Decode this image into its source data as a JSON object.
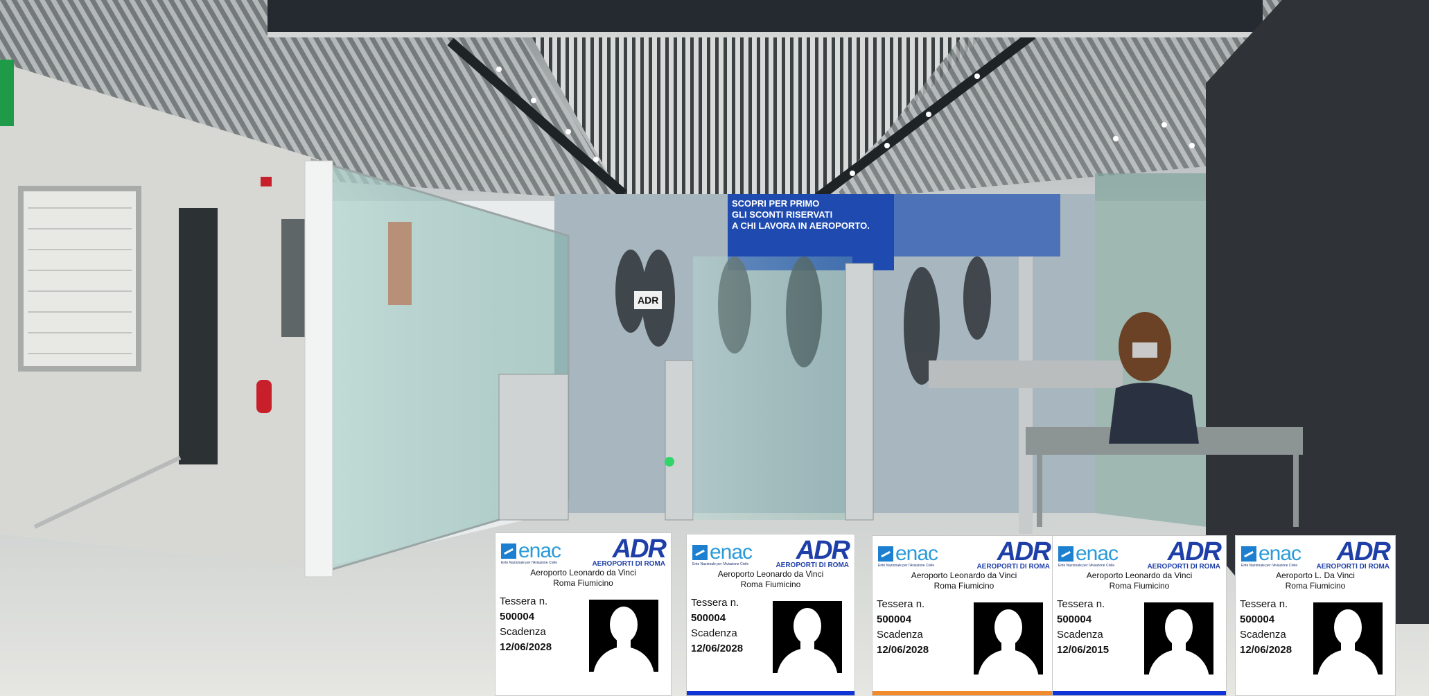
{
  "scene": {
    "signage_text": [
      "SCOPRI PER PRIMO",
      "GLI SCONTI RISERVATI",
      "A CHI LAVORA IN AEROPORTO."
    ],
    "gate_brand": "ADR"
  },
  "badges": [
    {
      "enac_logo": "enac",
      "enac_subtitle": "Ente Nazionale per l'Aviazione Civile",
      "adr_logo": "ADR",
      "adr_subtitle": "AEROPORTI DI ROMA",
      "airport_line1": "Aeroporto Leonardo da Vinci",
      "airport_line2": "Roma Fiumicino",
      "tessera_label": "Tessera n.",
      "tessera_number": "500004",
      "scadenza_label": "Scadenza",
      "scadenza_date": "12/06/2028",
      "band_color": "#ffffff"
    },
    {
      "enac_logo": "enac",
      "enac_subtitle": "Ente Nazionale per l'Aviazione Civile",
      "adr_logo": "ADR",
      "adr_subtitle": "AEROPORTI DI ROMA",
      "airport_line1": "Aeroporto Leonardo da Vinci",
      "airport_line2": "Roma Fiumicino",
      "tessera_label": "Tessera n.",
      "tessera_number": "500004",
      "scadenza_label": "Scadenza",
      "scadenza_date": "12/06/2028",
      "band_color": "#1034d6"
    },
    {
      "enac_logo": "enac",
      "enac_subtitle": "Ente Nazionale per l'Aviazione Civile",
      "adr_logo": "ADR",
      "adr_subtitle": "AEROPORTI DI ROMA",
      "airport_line1": "Aeroporto Leonardo da Vinci",
      "airport_line2": "Roma Fiumicino",
      "tessera_label": "Tessera n.",
      "tessera_number": "500004",
      "scadenza_label": "Scadenza",
      "scadenza_date": "12/06/2028",
      "band_color": "#f08a2a"
    },
    {
      "enac_logo": "enac",
      "enac_subtitle": "Ente Nazionale per l'Aviazione Civile",
      "adr_logo": "ADR",
      "adr_subtitle": "AEROPORTI DI ROMA",
      "airport_line1": "Aeroporto Leonardo da Vinci",
      "airport_line2": "Roma Fiumicino",
      "tessera_label": "Tessera n.",
      "tessera_number": "500004",
      "scadenza_label": "Scadenza",
      "scadenza_date": "12/06/2015",
      "band_color": "#1034d6"
    },
    {
      "enac_logo": "enac",
      "enac_subtitle": "Ente Nazionale per l'Aviazione Civile",
      "adr_logo": "ADR",
      "adr_subtitle": "AEROPORTI DI ROMA",
      "airport_line1": "Aeroporto L. Da Vinci",
      "airport_line2": "Roma Fiumicino",
      "tessera_label": "Tessera n.",
      "tessera_number": "500004",
      "scadenza_label": "Scadenza",
      "scadenza_date": "12/06/2028",
      "band_color": "#ffffff"
    }
  ]
}
